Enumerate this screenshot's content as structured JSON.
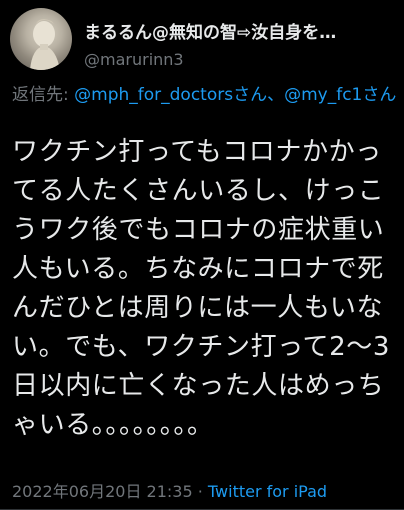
{
  "author": {
    "display_name": "まるるん@無知の智⇨汝自身を…",
    "handle": "@marurinn3"
  },
  "reply": {
    "prefix": "返信先: ",
    "mention_1": "@mph_for_doctorsさん",
    "separator": "、",
    "mention_2": "@my_fc1さん"
  },
  "tweet": {
    "text": "ワクチン打ってもコロナかかってる人たくさんいるし、けっこうワク後でもコロナの症状重い人もいる。ちなみにコロナで死んだひとは周りには一人もいない。でも、ワクチン打って2〜3日以内に亡くなった人はめっちゃいる。。。。。。。。"
  },
  "meta": {
    "timestamp": "2022年06月20日 21:35",
    "separator": " · ",
    "source": "Twitter for iPad"
  },
  "icons": {
    "avatar": "statue-avatar-icon"
  }
}
